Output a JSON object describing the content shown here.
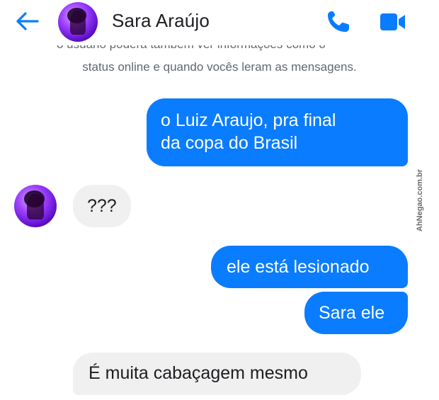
{
  "header": {
    "contact_name": "Sara Araújo",
    "icons": {
      "back": "back-arrow-icon",
      "call": "phone-icon",
      "video": "video-camera-icon"
    },
    "accent_color": "#0a7cff"
  },
  "notice": {
    "text": "status online e quando vocês leram as mensagens."
  },
  "messages": [
    {
      "direction": "sent",
      "text_line1": "o Luiz Araujo, pra final",
      "text_line2": "da copa do Brasil"
    },
    {
      "direction": "received",
      "text": "???"
    },
    {
      "direction": "sent",
      "text": "ele está lesionado"
    },
    {
      "direction": "sent",
      "text": "Sara ele"
    },
    {
      "direction": "received",
      "text": "É muita cabaçagem mesmo"
    }
  ],
  "watermark": "AhNegao.com.br",
  "colors": {
    "sent_bubble": "#0a7cff",
    "received_bubble": "#f1f0f0",
    "notice_text": "#606770"
  }
}
